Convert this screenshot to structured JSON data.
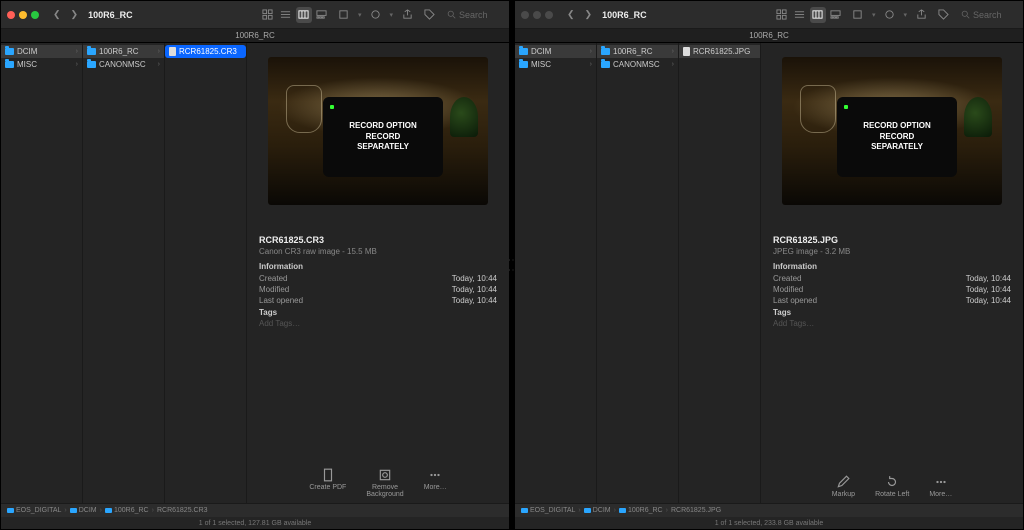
{
  "left": {
    "title": "100R6_RC",
    "search_placeholder": "Search",
    "tab": "100R6_RC",
    "columns": [
      [
        {
          "name": "DCIM",
          "type": "folder",
          "sel": true
        },
        {
          "name": "MISC",
          "type": "folder"
        }
      ],
      [
        {
          "name": "100R6_RC",
          "type": "folder",
          "sel": true
        },
        {
          "name": "CANONMSC",
          "type": "folder"
        }
      ],
      [
        {
          "name": "RCR61825.CR3",
          "type": "file",
          "hl": true
        }
      ]
    ],
    "preview": {
      "thumb_text_1": "RECORD OPTION",
      "thumb_text_2": "RECORD",
      "thumb_text_3": "SEPARATELY",
      "filename": "RCR61825.CR3",
      "subtitle": "Canon CR3 raw image - 15.5 MB",
      "info_label": "Information",
      "rows": [
        {
          "k": "Created",
          "v": "Today, 10:44"
        },
        {
          "k": "Modified",
          "v": "Today, 10:44"
        },
        {
          "k": "Last opened",
          "v": "Today, 10:44"
        }
      ],
      "tags_label": "Tags",
      "add_tags": "Add Tags…"
    },
    "actions": [
      {
        "label": "Create PDF",
        "icon": "doc"
      },
      {
        "label": "Remove\nBackground",
        "icon": "bg"
      },
      {
        "label": "More…",
        "icon": "more"
      }
    ],
    "path": [
      "EOS_DIGITAL",
      "DCIM",
      "100R6_RC",
      "RCR61825.CR3"
    ],
    "status": "1 of 1 selected, 127.81 GB available"
  },
  "right": {
    "title": "100R6_RC",
    "search_placeholder": "Search",
    "tab": "100R6_RC",
    "columns": [
      [
        {
          "name": "DCIM",
          "type": "folder",
          "sel": true
        },
        {
          "name": "MISC",
          "type": "folder"
        }
      ],
      [
        {
          "name": "100R6_RC",
          "type": "folder",
          "sel": true
        },
        {
          "name": "CANONMSC",
          "type": "folder"
        }
      ],
      [
        {
          "name": "RCR61825.JPG",
          "type": "file",
          "sel": true
        }
      ]
    ],
    "preview": {
      "thumb_text_1": "RECORD OPTION",
      "thumb_text_2": "RECORD",
      "thumb_text_3": "SEPARATELY",
      "filename": "RCR61825.JPG",
      "subtitle": "JPEG image - 3.2 MB",
      "info_label": "Information",
      "rows": [
        {
          "k": "Created",
          "v": "Today, 10:44"
        },
        {
          "k": "Modified",
          "v": "Today, 10:44"
        },
        {
          "k": "Last opened",
          "v": "Today, 10:44"
        }
      ],
      "tags_label": "Tags",
      "add_tags": "Add Tags…"
    },
    "actions": [
      {
        "label": "Markup",
        "icon": "markup"
      },
      {
        "label": "Rotate Left",
        "icon": "rotate"
      },
      {
        "label": "More…",
        "icon": "more"
      }
    ],
    "path": [
      "EOS_DIGITAL",
      "DCIM",
      "100R6_RC",
      "RCR61825.JPG"
    ],
    "status": "1 of 1 selected, 233.8 GB available"
  }
}
